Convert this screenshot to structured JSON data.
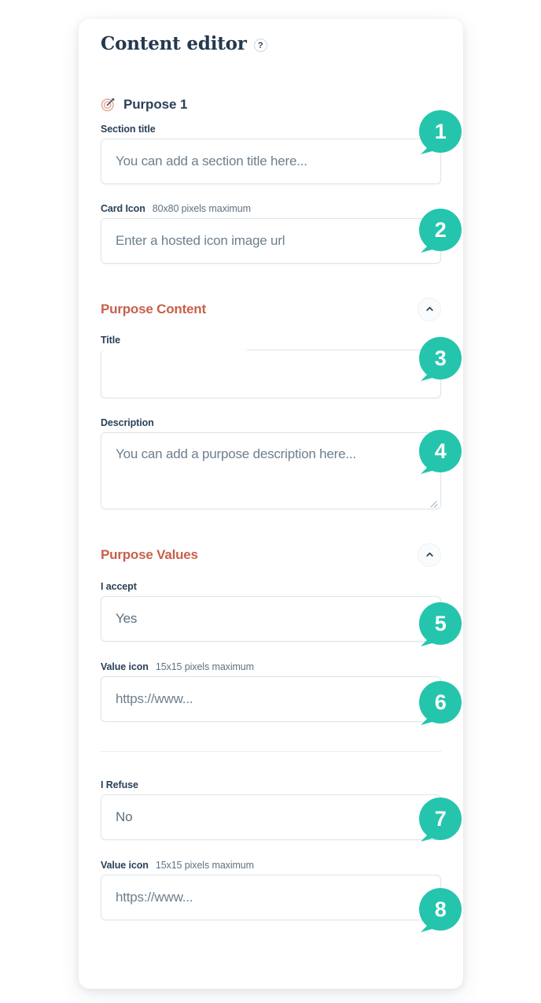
{
  "header": {
    "title": "Content editor",
    "help_icon": "question-mark-circle-icon",
    "help_label": "?"
  },
  "purpose": {
    "icon": "target-dart-icon",
    "label": "Purpose 1"
  },
  "fields": {
    "section_title": {
      "label": "Section title",
      "hint": "",
      "placeholder": "You can add a section title here...",
      "value": ""
    },
    "card_icon": {
      "label": "Card Icon",
      "hint": "80x80 pixels maximum",
      "placeholder": "Enter a hosted icon image url",
      "value": ""
    },
    "title": {
      "label": "Title",
      "hint": "",
      "placeholder": "",
      "value": ""
    },
    "description": {
      "label": "Description",
      "hint": "",
      "placeholder": "You can add a purpose description here...",
      "value": ""
    },
    "i_accept": {
      "label": "I accept",
      "hint": "",
      "placeholder": "",
      "value": "Yes"
    },
    "accept_value_icon": {
      "label": "Value icon",
      "hint": "15x15 pixels maximum",
      "placeholder": "https://www...",
      "value": ""
    },
    "i_refuse": {
      "label": "I Refuse",
      "hint": "",
      "placeholder": "",
      "value": "No"
    },
    "refuse_value_icon": {
      "label": "Value icon",
      "hint": "15x15 pixels maximum",
      "placeholder": "https://www...",
      "value": ""
    }
  },
  "sections": {
    "purpose_content": {
      "title": "Purpose Content",
      "collapse_icon": "chevron-up-icon"
    },
    "purpose_values": {
      "title": "Purpose Values",
      "collapse_icon": "chevron-up-icon"
    }
  },
  "callouts": [
    {
      "number": "1"
    },
    {
      "number": "2"
    },
    {
      "number": "3"
    },
    {
      "number": "4"
    },
    {
      "number": "5"
    },
    {
      "number": "6"
    },
    {
      "number": "7"
    },
    {
      "number": "8"
    }
  ],
  "colors": {
    "accent_teal": "#24c5ac",
    "section_orange": "#c8604a",
    "text_navy": "#2b4157",
    "border": "#dbe6ea",
    "placeholder": "#6d7f8e"
  }
}
